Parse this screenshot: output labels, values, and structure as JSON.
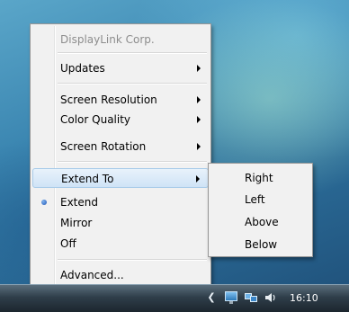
{
  "menu": {
    "items": [
      {
        "label": "DisplayLink Corp.",
        "disabled": true
      },
      {
        "label": "Updates",
        "submenu": true
      },
      {
        "label": "Screen Resolution",
        "submenu": true
      },
      {
        "label": "Color Quality",
        "submenu": true
      },
      {
        "label": "Screen Rotation",
        "submenu": true
      },
      {
        "label": "Extend To",
        "submenu": true,
        "highlighted": true
      },
      {
        "label": "Extend",
        "selected": true
      },
      {
        "label": "Mirror"
      },
      {
        "label": "Off"
      },
      {
        "label": "Advanced..."
      }
    ]
  },
  "submenu": {
    "items": [
      {
        "label": "Right"
      },
      {
        "label": "Left"
      },
      {
        "label": "Above"
      },
      {
        "label": "Below"
      }
    ]
  },
  "taskbar": {
    "clock": "16:10",
    "tray_icons": [
      "chevron-left-icon",
      "displaylink-monitor-icon",
      "network-icon",
      "volume-icon"
    ]
  },
  "colors": {
    "menu_background": "#f1f1f1",
    "highlight": "#cfe3f6",
    "radio_selected": "#1e56b5",
    "taskbar": "#2f3e4a"
  }
}
